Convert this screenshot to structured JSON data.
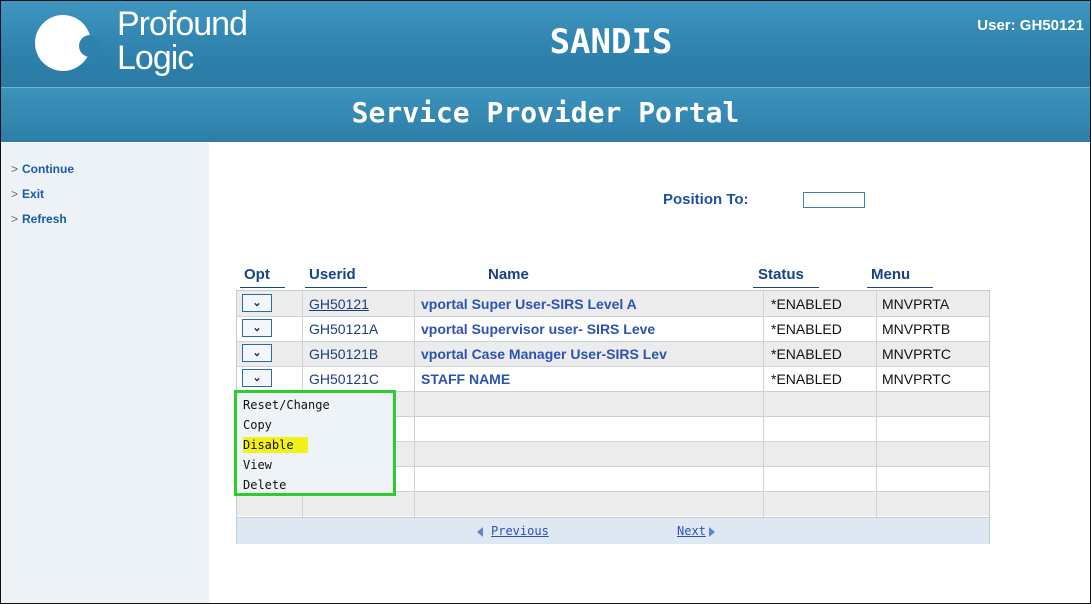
{
  "header": {
    "logo_line1": "Profound",
    "logo_line2": "Logic",
    "app_title": "SANDIS",
    "user_label": "User: GH50121",
    "portal_title": "Service Provider Portal"
  },
  "sidebar": {
    "items": [
      {
        "label": "Continue"
      },
      {
        "label": "Exit"
      },
      {
        "label": "Refresh"
      }
    ]
  },
  "position_to": {
    "label": "Position To:",
    "value": ""
  },
  "table": {
    "columns": [
      "Opt",
      "Userid",
      "Name",
      "Status",
      "Menu"
    ],
    "rows": [
      {
        "userid": "GH50121",
        "name": "vportal Super User-SIRS Level A",
        "status": "*ENABLED",
        "menu": "MNVPRTA"
      },
      {
        "userid": "GH50121A",
        "name": "vportal Supervisor user- SIRS Leve",
        "status": "*ENABLED",
        "menu": "MNVPRTB"
      },
      {
        "userid": "GH50121B",
        "name": "vportal Case Manager User-SIRS Lev",
        "status": "*ENABLED",
        "menu": "MNVPRTC"
      },
      {
        "userid": "GH50121C",
        "name": "STAFF NAME",
        "status": "*ENABLED",
        "menu": "MNVPRTC"
      }
    ],
    "opt_icon": "chevron-down-icon"
  },
  "pager": {
    "previous_label": "Previous",
    "next_label": "Next"
  },
  "dropdown": {
    "items": [
      "Reset/Change",
      "Copy",
      "Disable",
      "View",
      "Delete"
    ],
    "highlighted": "Disable",
    "highlight_color": "#f2f21a",
    "border_color": "#2ecc2e"
  }
}
